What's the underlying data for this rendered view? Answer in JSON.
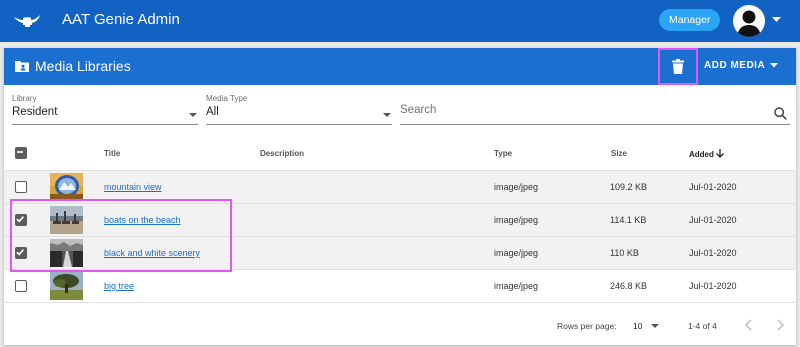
{
  "app": {
    "title": "AAT Genie Admin",
    "role": "Manager",
    "accent": "#1262c4",
    "highlight": "#e057f5"
  },
  "card": {
    "title": "Media Libraries",
    "add_media_label": "ADD MEDIA"
  },
  "filters": {
    "library": {
      "label": "Library",
      "value": "Resident"
    },
    "media_type": {
      "label": "Media Type",
      "value": "All"
    },
    "search_placeholder": "Search"
  },
  "table": {
    "headers": {
      "title": "Title",
      "description": "Description",
      "type": "Type",
      "size": "Size",
      "added": "Added"
    },
    "rows": [
      {
        "title": "mountain view",
        "description": "",
        "type": "image/jpeg",
        "size": "109.2 KB",
        "added": "Jul-01-2020",
        "checked": false,
        "thumb": "mountain-thumbnail"
      },
      {
        "title": "boats on the beach",
        "description": "",
        "type": "image/jpeg",
        "size": "114.1 KB",
        "added": "Jul-01-2020",
        "checked": true,
        "thumb": "boats-thumbnail"
      },
      {
        "title": "black and white scenery",
        "description": "",
        "type": "image/jpeg",
        "size": "110 KB",
        "added": "Jul-01-2020",
        "checked": true,
        "thumb": "bw-scenery-thumbnail"
      },
      {
        "title": "big tree",
        "description": "",
        "type": "image/jpeg",
        "size": "246.8 KB",
        "added": "Jul-01-2020",
        "checked": false,
        "thumb": "tree-thumbnail"
      }
    ]
  },
  "footer": {
    "rows_per_page_label": "Rows per page:",
    "rows_per_page_value": "10",
    "page_range": "1-4 of 4"
  }
}
